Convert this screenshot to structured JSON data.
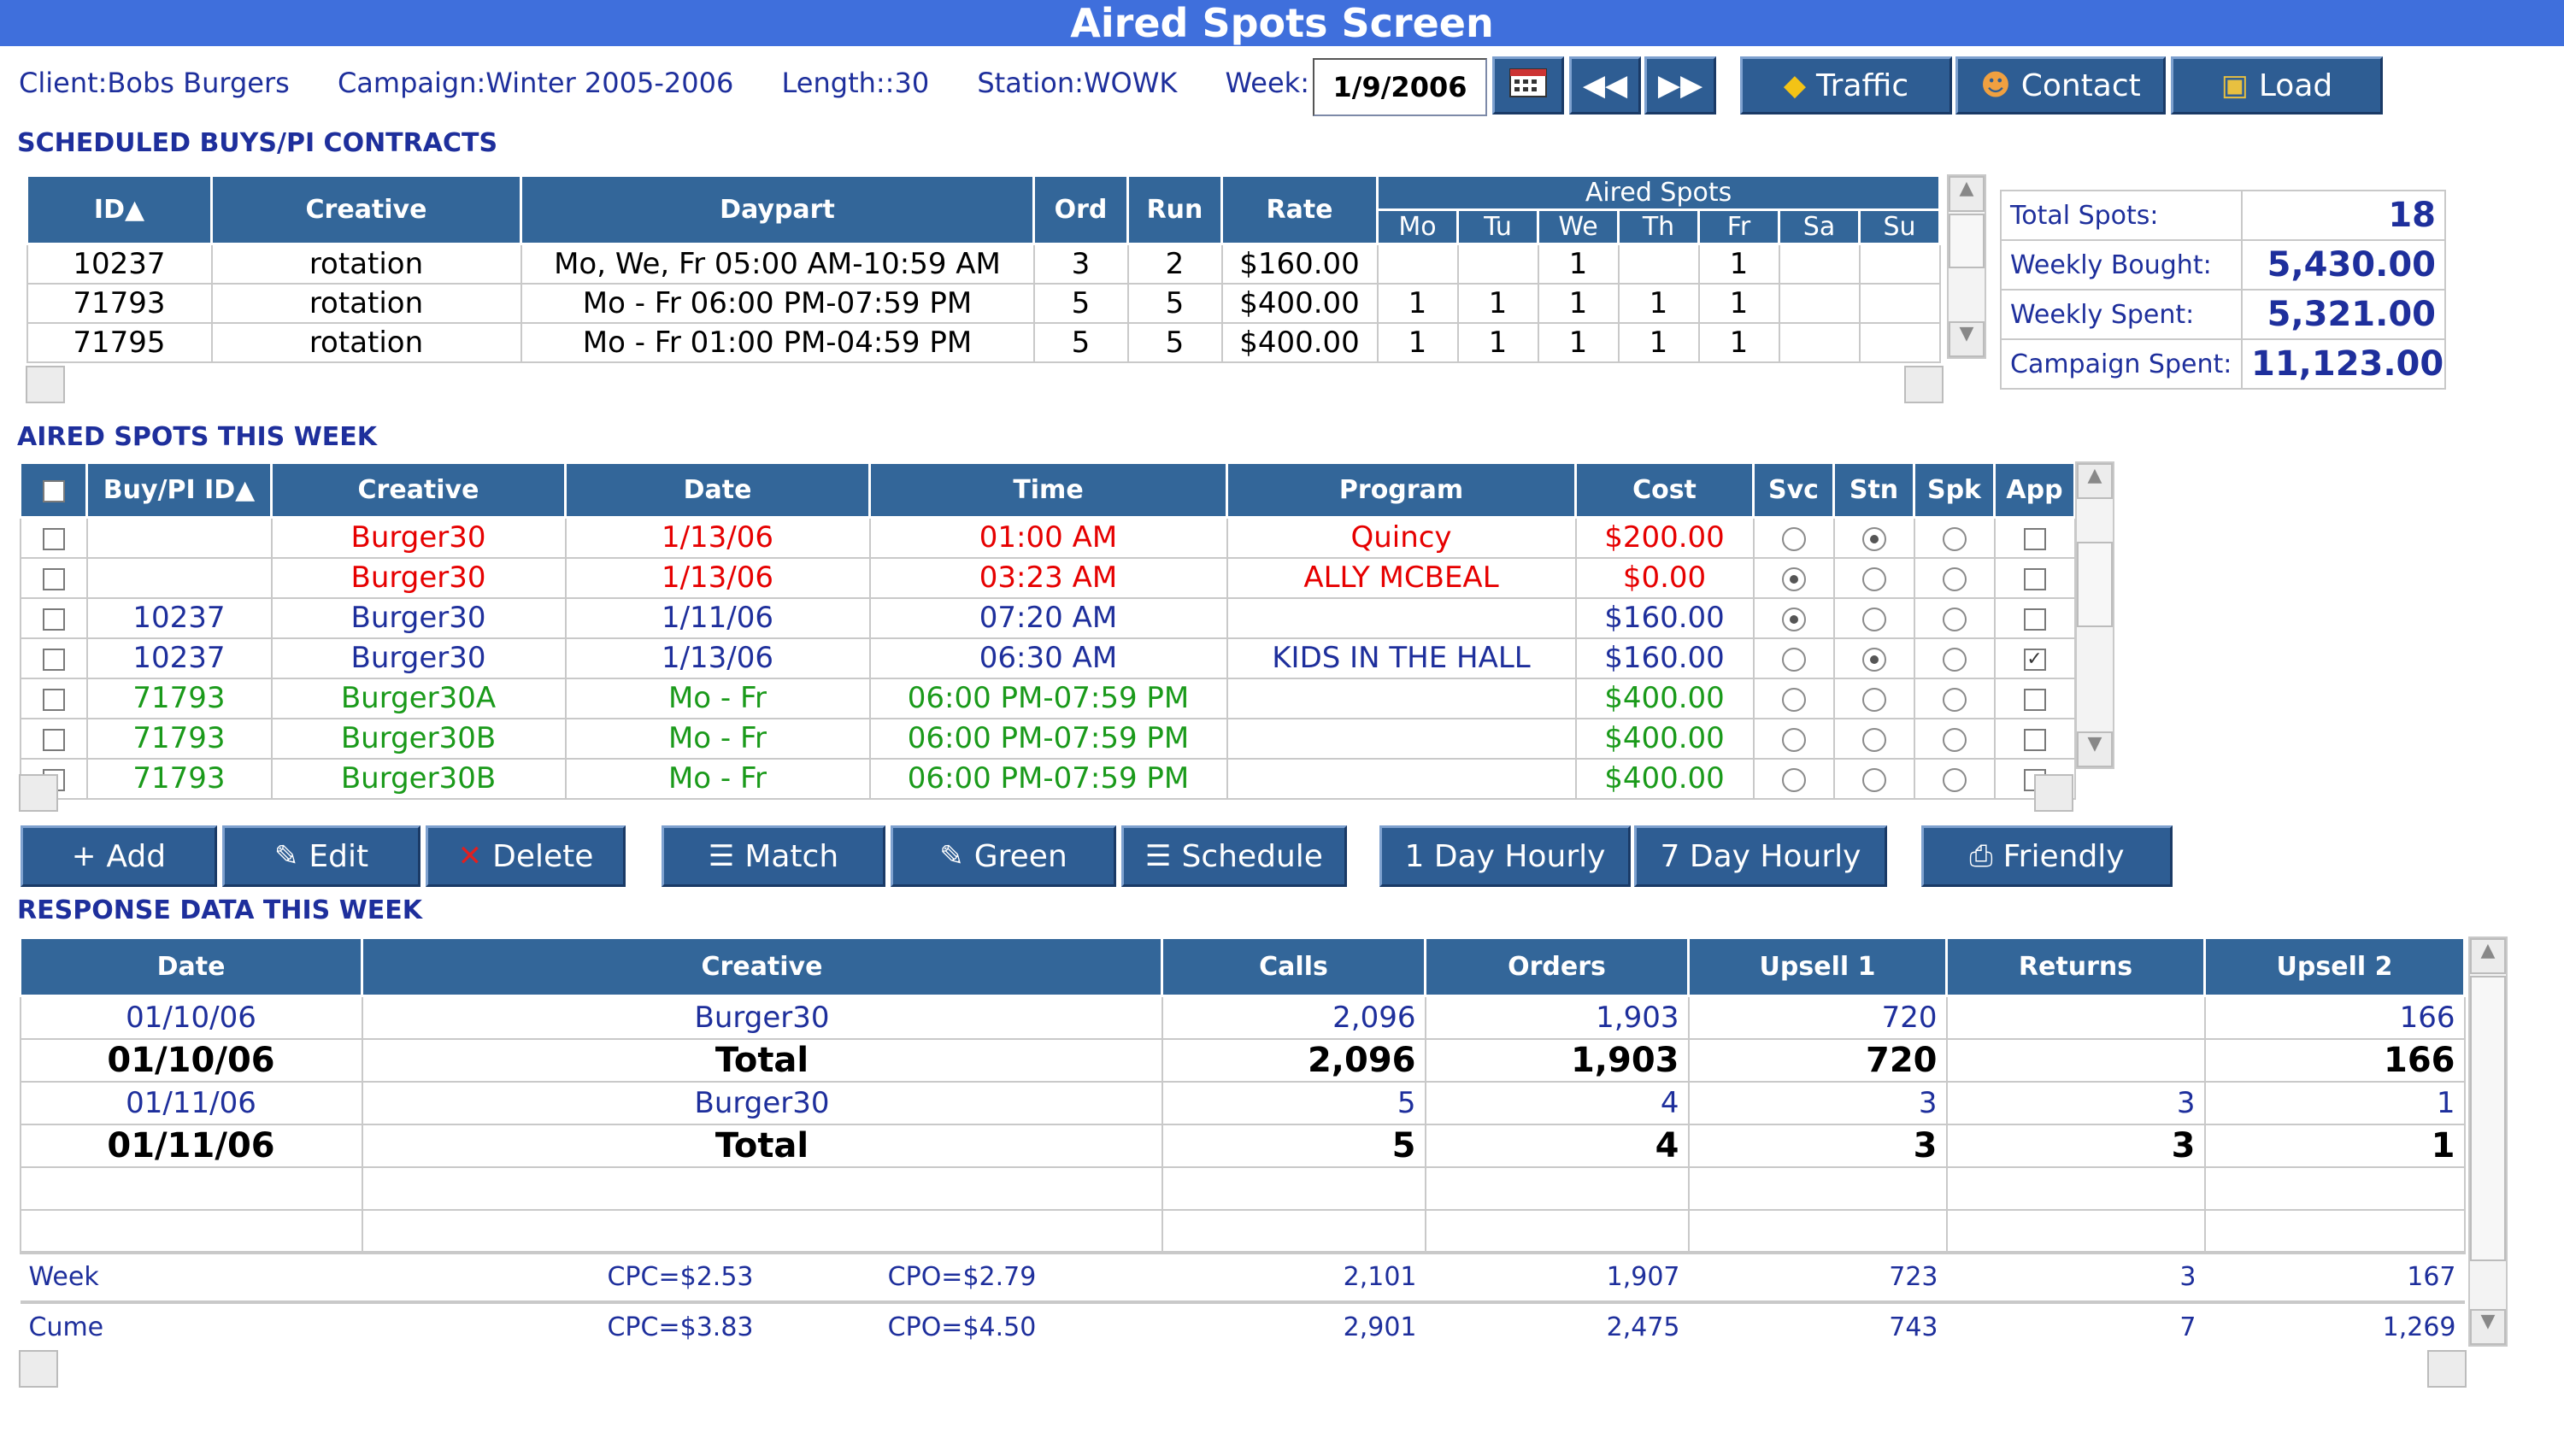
{
  "window": {
    "title": "Aired Spots Screen"
  },
  "info": {
    "client_label": "Client:",
    "client": "Bobs Burgers",
    "campaign_label": "Campaign:",
    "campaign": "Winter 2005-2006",
    "length_label": "Length:",
    "length": ":30",
    "station_label": "Station:",
    "station": "WOWK",
    "week_label": "Week:",
    "week": "1/9/2006"
  },
  "toolbar": {
    "traffic": "Traffic",
    "contact": "Contact",
    "load": "Load"
  },
  "sections": {
    "scheduled": "SCHEDULED BUYS/PI CONTRACTS",
    "aired": "AIRED SPOTS THIS WEEK",
    "response": "RESPONSE DATA THIS WEEK"
  },
  "scheduled": {
    "headers": {
      "id": "ID",
      "creative": "Creative",
      "daypart": "Daypart",
      "ord": "Ord",
      "run": "Run",
      "rate": "Rate",
      "aired_group": "Aired Spots"
    },
    "days": [
      "Mo",
      "Tu",
      "We",
      "Th",
      "Fr",
      "Sa",
      "Su"
    ],
    "rows": [
      {
        "id": "10237",
        "creative": "rotation",
        "daypart": "Mo, We, Fr 05:00 AM-10:59 AM",
        "ord": "3",
        "run": "2",
        "rate": "$160.00",
        "days": [
          "",
          "",
          "1",
          "",
          "1",
          "",
          ""
        ]
      },
      {
        "id": "71793",
        "creative": "rotation",
        "daypart": "Mo - Fr 06:00 PM-07:59 PM",
        "ord": "5",
        "run": "5",
        "rate": "$400.00",
        "days": [
          "1",
          "1",
          "1",
          "1",
          "1",
          "",
          ""
        ]
      },
      {
        "id": "71795",
        "creative": "rotation",
        "daypart": "Mo - Fr 01:00 PM-04:59 PM",
        "ord": "5",
        "run": "5",
        "rate": "$400.00",
        "days": [
          "1",
          "1",
          "1",
          "1",
          "1",
          "",
          ""
        ]
      }
    ]
  },
  "totals": [
    {
      "label": "Total Spots:",
      "value": "18"
    },
    {
      "label": "Weekly Bought:",
      "value": "5,430.00"
    },
    {
      "label": "Weekly Spent:",
      "value": "5,321.00"
    },
    {
      "label": "Campaign Spent:",
      "value": "11,123.00"
    }
  ],
  "aired": {
    "headers": {
      "buy": "Buy/PI ID",
      "creative": "Creative",
      "date": "Date",
      "time": "Time",
      "program": "Program",
      "cost": "Cost",
      "svc": "Svc",
      "stn": "Stn",
      "spk": "Spk",
      "app": "App"
    },
    "rows": [
      {
        "buy": "",
        "creative": "Burger30",
        "date": "1/13/06",
        "time": "01:00 AM",
        "program": "Quincy",
        "cost": "$200.00",
        "color": "#e60000"
      },
      {
        "buy": "",
        "creative": "Burger30",
        "date": "1/13/06",
        "time": "03:23 AM",
        "program": "ALLY MCBEAL",
        "cost": "$0.00",
        "color": "#e60000"
      },
      {
        "buy": "10237",
        "creative": "Burger30",
        "date": "1/11/06",
        "time": "07:20 AM",
        "program": "",
        "cost": "$160.00",
        "color": "#1e2f9c"
      },
      {
        "buy": "10237",
        "creative": "Burger30",
        "date": "1/13/06",
        "time": "06:30 AM",
        "program": "KIDS IN THE HALL",
        "cost": "$160.00",
        "color": "#1e2f9c"
      },
      {
        "buy": "71793",
        "creative": "Burger30A",
        "date": "Mo - Fr",
        "time": "06:00 PM-07:59 PM",
        "program": "",
        "cost": "$400.00",
        "color": "#1a9a1a"
      },
      {
        "buy": "71793",
        "creative": "Burger30B",
        "date": "Mo - Fr",
        "time": "06:00 PM-07:59 PM",
        "program": "",
        "cost": "$400.00",
        "color": "#1a9a1a"
      },
      {
        "buy": "71793",
        "creative": "Burger30B",
        "date": "Mo - Fr",
        "time": "06:00 PM-07:59 PM",
        "program": "",
        "cost": "$400.00",
        "color": "#1a9a1a"
      }
    ]
  },
  "actions": {
    "add": "Add",
    "edit": "Edit",
    "delete": "Delete",
    "match": "Match",
    "green": "Green",
    "schedule": "Schedule",
    "hourly1": "1 Day Hourly",
    "hourly7": "7 Day Hourly",
    "friendly": "Friendly"
  },
  "response": {
    "headers": {
      "date": "Date",
      "creative": "Creative",
      "calls": "Calls",
      "orders": "Orders",
      "upsell1": "Upsell 1",
      "returns": "Returns",
      "upsell2": "Upsell 2"
    },
    "rows": [
      {
        "date": "01/10/06",
        "creative": "Burger30",
        "calls": "2,096",
        "orders": "1,903",
        "upsell1": "720",
        "returns": "",
        "upsell2": "166"
      },
      {
        "date": "01/10/06",
        "creative": "Total",
        "calls": "2,096",
        "orders": "1,903",
        "upsell1": "720",
        "returns": "",
        "upsell2": "166"
      },
      {
        "date": "01/11/06",
        "creative": "Burger30",
        "calls": "5",
        "orders": "4",
        "upsell1": "3",
        "returns": "3",
        "upsell2": "1"
      },
      {
        "date": "01/11/06",
        "creative": "Total",
        "calls": "5",
        "orders": "4",
        "upsell1": "3",
        "returns": "3",
        "upsell2": "1"
      }
    ],
    "footer": [
      {
        "label": "Week",
        "cpc": "CPC=$2.53",
        "cpo": "CPO=$2.79",
        "calls": "2,101",
        "orders": "1,907",
        "upsell1": "723",
        "returns": "3",
        "upsell2": "167"
      },
      {
        "label": "Cume",
        "cpc": "CPC=$3.83",
        "cpo": "CPO=$4.50",
        "calls": "2,901",
        "orders": "2,475",
        "upsell1": "743",
        "returns": "7",
        "upsell2": "1,269"
      }
    ]
  },
  "colors": {
    "header": "#336699",
    "title": "#3f6fdc",
    "red": "#e60000",
    "green": "#1a9a1a",
    "navy": "#1e2f9c"
  }
}
